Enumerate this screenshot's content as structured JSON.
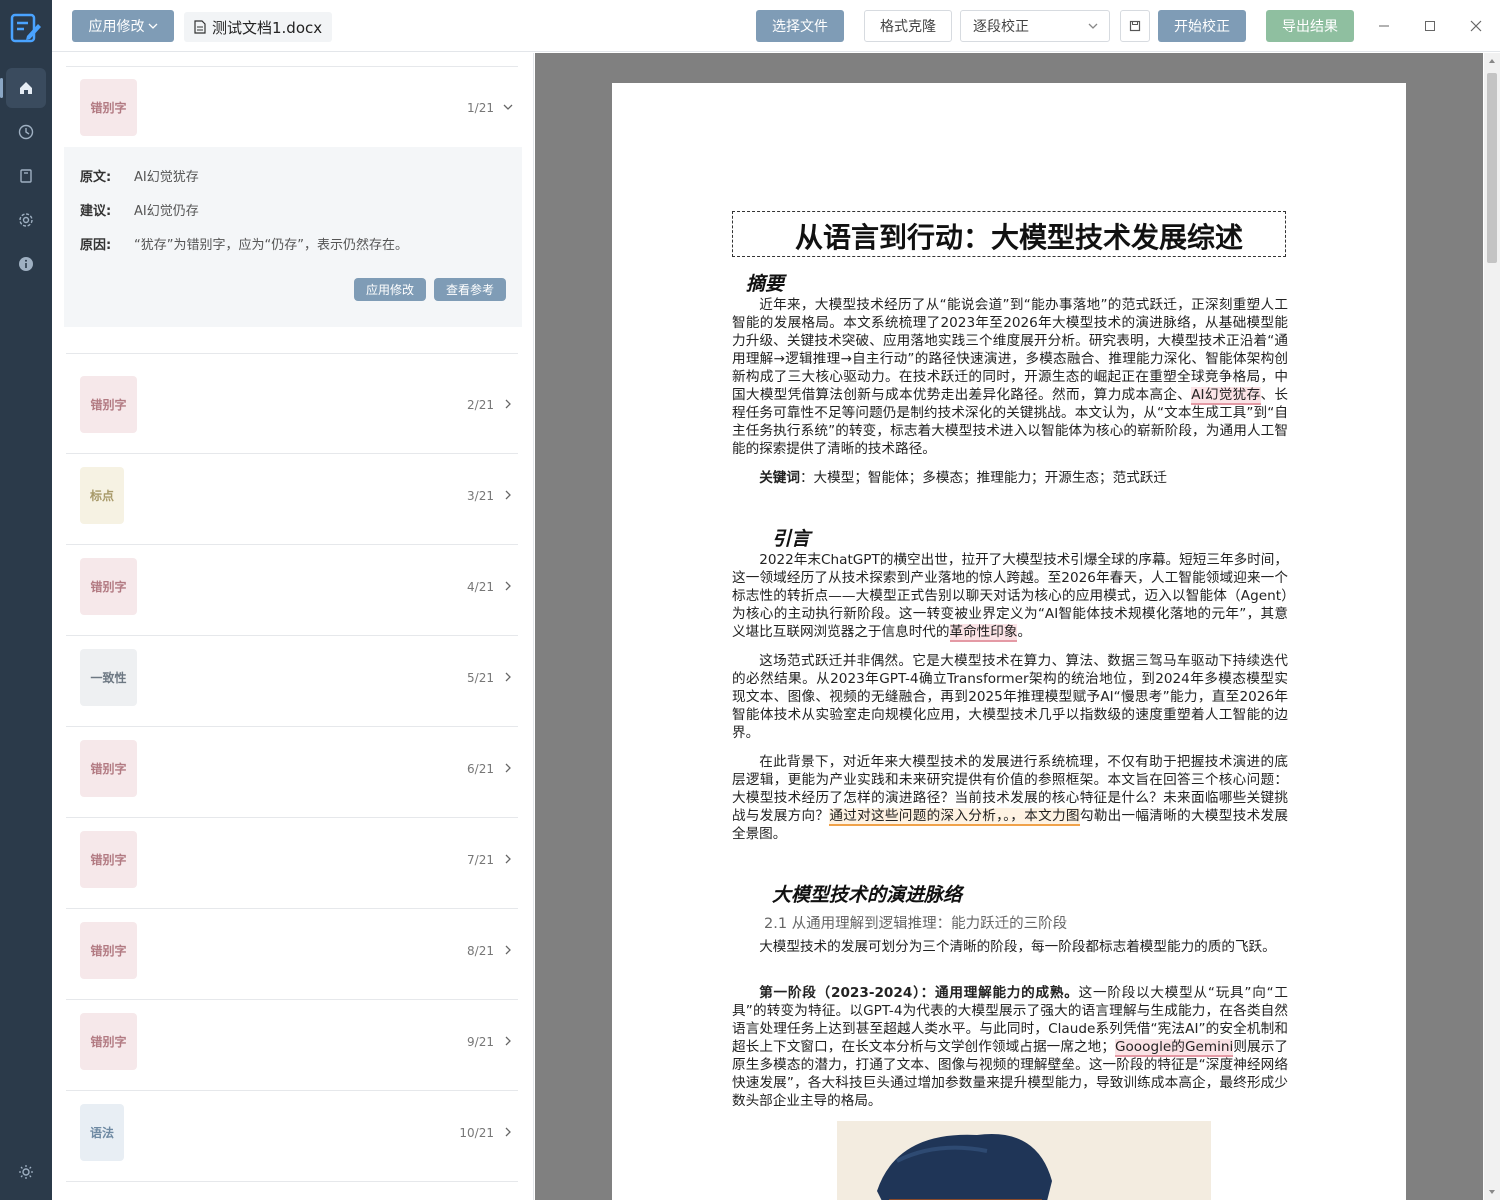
{
  "toolbar": {
    "apply_label": "应用修改",
    "file_name": "测试文档1.docx",
    "select_file": "选择文件",
    "format_clone": "格式克隆",
    "mode": "逐段校正",
    "start": "开始校正",
    "export": "导出结果"
  },
  "detail": {
    "type": "错别字",
    "count": "1/21",
    "original_label": "原文:",
    "original": "AI幻觉犹存",
    "suggest_label": "建议:",
    "suggest": "AI幻觉仍存",
    "reason_label": "原因:",
    "reason": "“犹存”为错别字，应为“仍存”，表示仍然存在。",
    "apply_btn": "应用修改",
    "ref_btn": "查看参考"
  },
  "issues": [
    {
      "type": "错别字",
      "count": "2/21"
    },
    {
      "type": "标点",
      "count": "3/21"
    },
    {
      "type": "错别字",
      "count": "4/21"
    },
    {
      "type": "一致性",
      "count": "5/21"
    },
    {
      "type": "错别字",
      "count": "6/21"
    },
    {
      "type": "错别字",
      "count": "7/21"
    },
    {
      "type": "错别字",
      "count": "8/21"
    },
    {
      "type": "错别字",
      "count": "9/21"
    },
    {
      "type": "语法",
      "count": "10/21"
    }
  ],
  "doc": {
    "title": "从语言到行动：大模型技术发展综述",
    "abstract_h": "摘要",
    "abstract_a": "近年来，大模型技术经历了从“能说会道”到“能办事落地”的范式跃迁，正深刻重塑人工智能的发展格局。本文系统梳理了2023年至2026年大模型技术的演进脉络，从基础模型能力升级、关键技术突破、应用落地实践三个维度展开分析。研究表明，大模型技术正沿着“通用理解→逻辑推理→自主行动”的路径快速演进，多模态融合、推理能力深化、智能体架构创新构成了三大核心驱动力。在技术跃迁的同时，开源生态的崛起正在重塑全球竞争格局，中国大模型凭借算法创新与成本优势走出差异化路径。然而，算力成本高企、",
    "abstract_mark": "AI幻觉犹存",
    "abstract_b": "、长程任务可靠性不足等问题仍是制约技术深化的关键挑战。本文认为，从“文本生成工具”到“自主任务执行系统”的转变，标志着大模型技术进入以智能体为核心的崭新阶段，为通用人工智能的探索提供了清晰的技术路径。",
    "keywords_label": "关键词",
    "keywords": "：大模型；智能体；多模态；推理能力；开源生态；范式跃迁",
    "intro_h": "引言",
    "intro1_a": "2022年末ChatGPT的横空出世，拉开了大模型技术引爆全球的序幕。短短三年多时间，这一领域经历了从技术探索到产业落地的惊人跨越。至2026年春天，人工智能领域迎来一个标志性的转折点——大模型正式告别以聊天对话为核心的应用模式，迈入以智能体（Agent）为核心的主动执行新阶段。这一转变被业界定义为“AI智能体技术规模化落地的元年”，其意义堪比互联网浏览器之于信息时代的",
    "intro1_mark": "革命性印象",
    "intro1_b": "。",
    "intro2": "这场范式跃迁并非偶然。它是大模型技术在算力、算法、数据三驾马车驱动下持续迭代的必然结果。从2023年GPT-4确立Transformer架构的统治地位，到2024年多模态模型实现文本、图像、视频的无缝融合，再到2025年推理模型赋予AI“慢思考”能力，直至2026年智能体技术从实验室走向规模化应用，大模型技术几乎以指数级的速度重塑着人工智能的边界。",
    "intro3_a": "在此背景下，对近年来大模型技术的发展进行系统梳理，不仅有助于把握技术演进的底层逻辑，更能为产业实践和未来研究提供有价值的参照框架。本文旨在回答三个核心问题：大模型技术经历了怎样的演进路径？当前技术发展的核心特征是什么？未来面临哪些关键挑战与发展方向？",
    "intro3_mark": "通过对这些问题的深入分析，。，本文力图",
    "intro3_b": "勾勒出一幅清晰的大模型技术发展全景图。",
    "evo_h": "大模型技术的演进脉络",
    "evo_sub": "2.1 从通用理解到逻辑推理：能力跃迁的三阶段",
    "evo1": "大模型技术的发展可划分为三个清晰的阶段，每一阶段都标志着模型能力的质的飞跃。",
    "evo2_bold": "第一阶段（2023-2024）：通用理解能力的成熟。",
    "evo2_a": "这一阶段以大模型从“玩具”向“工具”的转变为特征。以GPT-4为代表的大模型展示了强大的语言理解与生成能力，在各类自然语言处理任务上达到甚至超越人类水平。与此同时，Claude系列凭借“宪法AI”的安全机制和超长上下文窗口，在长文本分析与文学创作领域占据一席之地；",
    "evo2_mark": "Gooogle的Gemini",
    "evo2_b": "则展示了原生多模态的潜力，打通了文本、图像与视频的理解壁垒。这一阶段的特征是“深度神经网络快速发展”，各大科技巨头通过增加参数量来提升模型能力，导致训练成本高企，最终形成少数头部企业主导的格局。"
  }
}
